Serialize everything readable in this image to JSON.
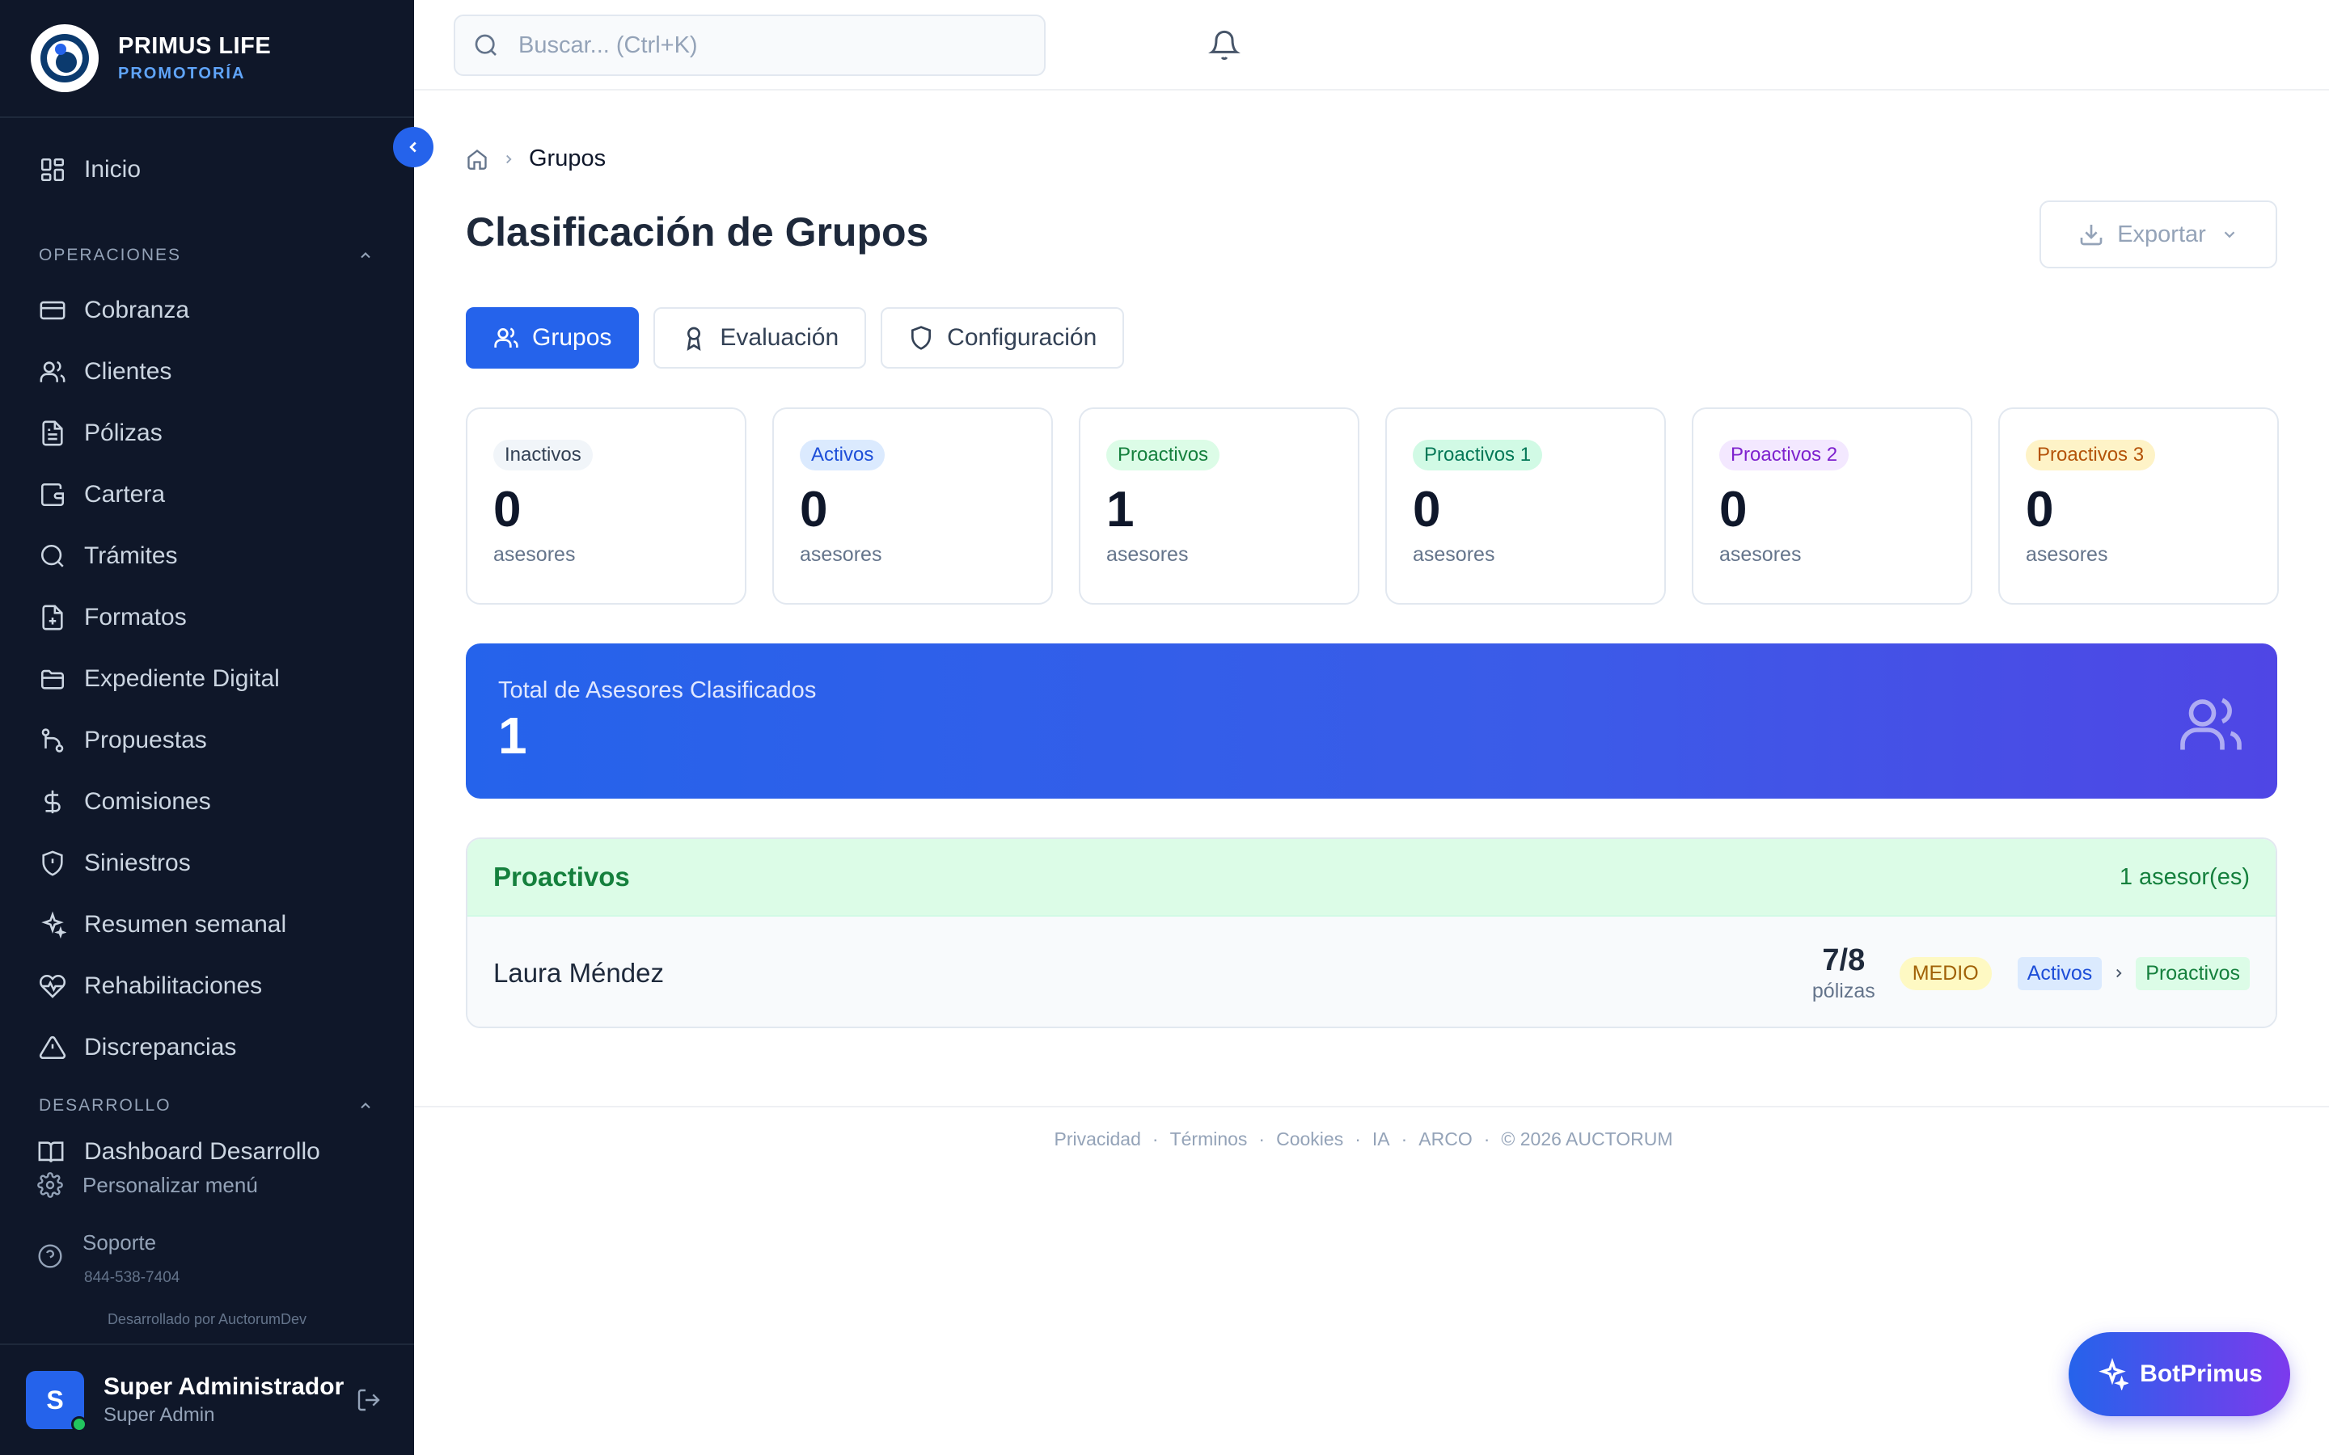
{
  "brand": {
    "name": "PRIMUS LIFE",
    "subtitle": "PROMOTORÍA"
  },
  "sidebar": {
    "home": {
      "label": "Inicio",
      "icon": "dashboard-icon"
    },
    "sections": [
      {
        "title": "OPERACIONES"
      },
      {
        "title": "DESARROLLO"
      }
    ],
    "items": [
      {
        "label": "Cobranza",
        "icon": "credit-card-icon"
      },
      {
        "label": "Clientes",
        "icon": "users-icon"
      },
      {
        "label": "Pólizas",
        "icon": "document-icon"
      },
      {
        "label": "Cartera",
        "icon": "wallet-icon"
      },
      {
        "label": "Trámites",
        "icon": "search-icon"
      },
      {
        "label": "Formatos",
        "icon": "file-icon"
      },
      {
        "label": "Expediente Digital",
        "icon": "folder-icon"
      },
      {
        "label": "Propuestas",
        "icon": "git-branch-icon"
      },
      {
        "label": "Comisiones",
        "icon": "dollar-icon"
      },
      {
        "label": "Siniestros",
        "icon": "shield-icon"
      },
      {
        "label": "Resumen semanal",
        "icon": "sparkle-icon"
      },
      {
        "label": "Rehabilitaciones",
        "icon": "heart-pulse-icon"
      },
      {
        "label": "Discrepancias",
        "icon": "warning-icon"
      }
    ],
    "dev_item": {
      "label": "Dashboard Desarrollo"
    },
    "customize": "Personalizar menú",
    "support": {
      "label": "Soporte",
      "phone": "844-538-7404"
    },
    "credit": "Desarrollado por AuctorumDev",
    "user": {
      "initial": "S",
      "name": "Super Administrador",
      "role": "Super Admin"
    }
  },
  "search": {
    "placeholder": "Buscar... (Ctrl+K)",
    "value": ""
  },
  "breadcrumb": {
    "current": "Grupos"
  },
  "page": {
    "title": "Clasificación de Grupos",
    "export_label": "Exportar"
  },
  "tabs": [
    {
      "label": "Grupos",
      "active": true
    },
    {
      "label": "Evaluación",
      "active": false
    },
    {
      "label": "Configuración",
      "active": false
    }
  ],
  "stats": [
    {
      "label": "Inactivos",
      "count": "0",
      "unit": "asesores",
      "bg": "#f1f5f9",
      "fg": "#334155"
    },
    {
      "label": "Activos",
      "count": "0",
      "unit": "asesores",
      "bg": "#dbeafe",
      "fg": "#1d4ed8"
    },
    {
      "label": "Proactivos",
      "count": "1",
      "unit": "asesores",
      "bg": "#dcfce7",
      "fg": "#15803d"
    },
    {
      "label": "Proactivos 1",
      "count": "0",
      "unit": "asesores",
      "bg": "#d1fae5",
      "fg": "#047857"
    },
    {
      "label": "Proactivos 2",
      "count": "0",
      "unit": "asesores",
      "bg": "#f3e8ff",
      "fg": "#7e22ce"
    },
    {
      "label": "Proactivos 3",
      "count": "0",
      "unit": "asesores",
      "bg": "#fef3c7",
      "fg": "#b45309"
    }
  ],
  "total": {
    "label": "Total de Asesores Clasificados",
    "value": "1"
  },
  "group": {
    "title": "Proactivos",
    "count_label": "1 asesor(es)",
    "rows": [
      {
        "name": "Laura Méndez",
        "polizas": "7/8",
        "polizas_unit": "pólizas",
        "level": "MEDIO",
        "from": "Activos",
        "to": "Proactivos"
      }
    ]
  },
  "footer": {
    "links": [
      "Privacidad",
      "Términos",
      "Cookies",
      "IA",
      "ARCO"
    ],
    "separator": "·",
    "copyright": "© 2026 AUCTORUM"
  },
  "bot": {
    "label": "BotPrimus"
  },
  "colors": {
    "sidebar_bg": "#0f1729",
    "accent": "#2563eb",
    "success": "#15803d"
  }
}
